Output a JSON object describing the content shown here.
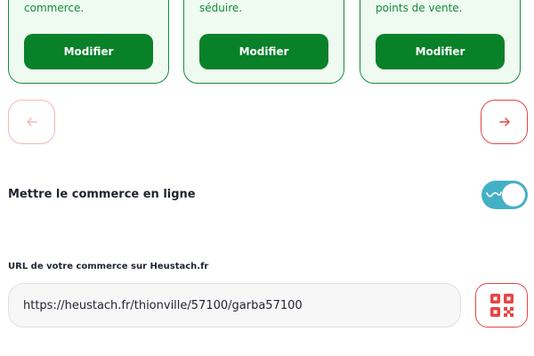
{
  "cards": [
    {
      "text": "commerce.",
      "button_label": "Modifier"
    },
    {
      "text": "séduire.",
      "button_label": "Modifier"
    },
    {
      "text": "points de vente.",
      "button_label": "Modifier"
    }
  ],
  "online": {
    "label": "Mettre le commerce en ligne",
    "enabled": true
  },
  "url": {
    "label": "URL de votre commerce sur Heustach.fr",
    "value": "https://heustach.fr/thionville/57100/garba57100"
  },
  "colors": {
    "primary_green": "#098129",
    "card_bg": "#effaf1",
    "accent_red": "#e54545",
    "toggle_teal": "#43b0c6"
  },
  "icons": {
    "prev": "arrow-left-icon",
    "next": "arrow-right-icon",
    "qr": "qr-code-icon"
  }
}
